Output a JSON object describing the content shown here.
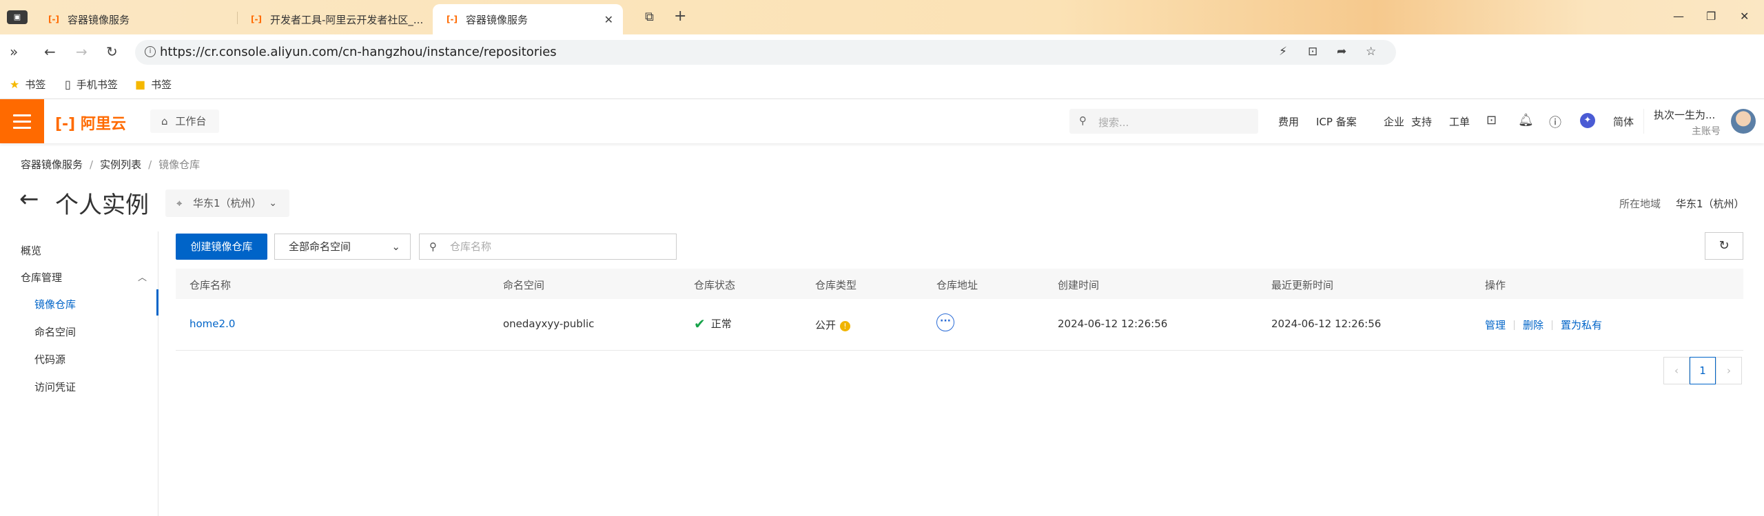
{
  "browser": {
    "tabs": [
      {
        "title": "容器镜像服务",
        "active": false
      },
      {
        "title": "开发者工具-阿里云开发者社区_..."
      },
      {
        "title": "容器镜像服务",
        "active": true
      }
    ],
    "url": "https://cr.console.aliyun.com/cn-hangzhou/instance/repositories",
    "bookmarks": [
      "书签",
      "手机书签",
      "书签"
    ]
  },
  "topnav": {
    "logo": "阿里云",
    "workbench": "工作台",
    "search_placeholder": "搜索...",
    "links": [
      "费用",
      "ICP 备案",
      "企业",
      "支持",
      "工单"
    ],
    "lang": "简体",
    "user_name": "执次一生为...",
    "user_sub": "主账号"
  },
  "breadcrumb": [
    "容器镜像服务",
    "实例列表",
    "镜像仓库"
  ],
  "header": {
    "title": "个人实例",
    "region_select": "华东1（杭州）",
    "region_label": "所在地域",
    "region_value": "华东1（杭州）"
  },
  "sidebar": {
    "overview": "概览",
    "group": "仓库管理",
    "items": [
      "镜像仓库",
      "命名空间",
      "代码源",
      "访问凭证"
    ]
  },
  "toolbar": {
    "create_button": "创建镜像仓库",
    "namespace_select": "全部命名空间",
    "search_placeholder": "仓库名称"
  },
  "table": {
    "columns": [
      "仓库名称",
      "命名空间",
      "仓库状态",
      "仓库类型",
      "仓库地址",
      "创建时间",
      "最近更新时间",
      "操作"
    ],
    "rows": [
      {
        "name": "home2.0",
        "namespace": "onedayxyy-public",
        "status": "正常",
        "type": "公开",
        "created": "2024-06-12 12:26:56",
        "updated": "2024-06-12 12:26:56",
        "actions": [
          "管理",
          "删除",
          "置为私有"
        ]
      }
    ]
  },
  "pagination": {
    "current": "1"
  },
  "colors": {
    "brand": "#ff6a00",
    "primary": "#0064c8",
    "success": "#17a34a",
    "warning": "#f0b400"
  }
}
